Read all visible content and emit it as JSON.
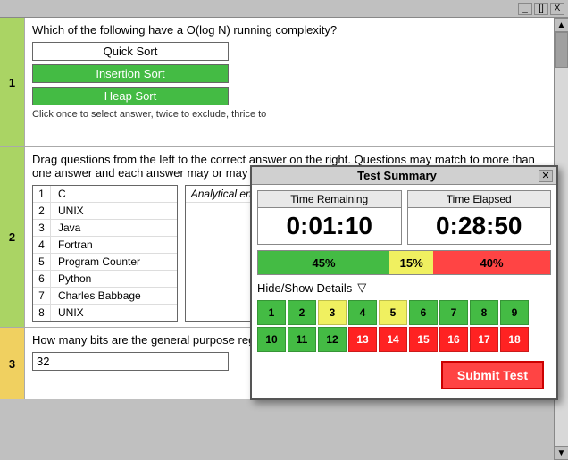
{
  "titlebar": {
    "minimize": "_",
    "restore": "[]",
    "close": "X"
  },
  "q1": {
    "number": "1",
    "question": "Which of the following have a O(log N) running complexity?",
    "options": [
      {
        "label": "Quick Sort",
        "selected": true
      },
      {
        "label": "Insertion Sort",
        "selected": true
      },
      {
        "label": "Heap Sort",
        "selected": true
      }
    ],
    "hint": "Click once to select answer, twice to exclude, thrice to"
  },
  "q2": {
    "number": "2",
    "question": "Drag questions from the left to the correct answer on the right.  Questions may match to more than one answer and each answer may or may not be used.",
    "items": [
      {
        "num": "1",
        "text": "C"
      },
      {
        "num": "2",
        "text": "UNIX"
      },
      {
        "num": "3",
        "text": "Java"
      },
      {
        "num": "4",
        "text": "Fortran"
      },
      {
        "num": "5",
        "text": "Program Counter"
      },
      {
        "num": "6",
        "text": "Python"
      },
      {
        "num": "7",
        "text": "Charles Babbage"
      },
      {
        "num": "8",
        "text": "UNIX"
      }
    ],
    "right_header": "Analytical engine"
  },
  "q3": {
    "number": "3",
    "question": "How many bits are the general purpose registers on a standard ARM processor?",
    "answer": "32"
  },
  "modal": {
    "title": "Test Summary",
    "time_remaining_label": "Time Remaining",
    "time_remaining_value": "0:01:10",
    "time_elapsed_label": "Time Elapsed",
    "time_elapsed_value": "0:28:50",
    "progress_green_pct": "45%",
    "progress_green_width": 45,
    "progress_yellow_pct": "15%",
    "progress_yellow_width": 15,
    "progress_red_pct": "40%",
    "progress_red_width": 40,
    "hide_show_label": "Hide/Show Details",
    "grid_row1": [
      {
        "num": "1",
        "color": "green"
      },
      {
        "num": "2",
        "color": "green"
      },
      {
        "num": "3",
        "color": "yellow"
      },
      {
        "num": "4",
        "color": "green"
      },
      {
        "num": "5",
        "color": "yellow"
      },
      {
        "num": "6",
        "color": "green"
      },
      {
        "num": "7",
        "color": "green"
      },
      {
        "num": "8",
        "color": "green"
      },
      {
        "num": "9",
        "color": "green"
      }
    ],
    "grid_row2": [
      {
        "num": "10",
        "color": "green"
      },
      {
        "num": "11",
        "color": "green"
      },
      {
        "num": "12",
        "color": "green"
      },
      {
        "num": "13",
        "color": "red"
      },
      {
        "num": "14",
        "color": "red"
      },
      {
        "num": "15",
        "color": "red"
      },
      {
        "num": "16",
        "color": "red"
      },
      {
        "num": "17",
        "color": "red"
      },
      {
        "num": "18",
        "color": "red"
      }
    ],
    "submit_label": "Submit Test"
  }
}
